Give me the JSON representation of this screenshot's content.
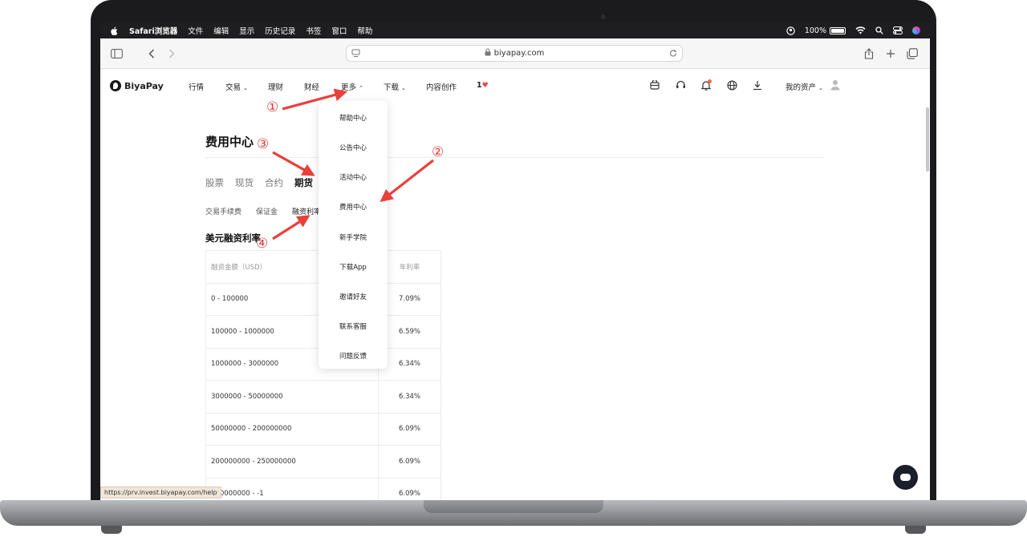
{
  "menubar": {
    "app": "Safari浏览器",
    "items": [
      "文件",
      "编辑",
      "显示",
      "历史记录",
      "书签",
      "窗口",
      "帮助"
    ],
    "battery_text": "100%"
  },
  "browser": {
    "url": "biyapay.com",
    "status_url": "https://prv.invest.biyapay.com/help"
  },
  "nav": {
    "logo": "BiyaPay",
    "items": [
      "行情",
      "交易",
      "理财",
      "财经",
      "更多",
      "下载",
      "内容创作",
      "1"
    ],
    "assets": "我的资产"
  },
  "dropdown": {
    "items": [
      "帮助中心",
      "公告中心",
      "活动中心",
      "费用中心",
      "新手学院",
      "下载App",
      "邀请好友",
      "联系客服",
      "问题反馈"
    ]
  },
  "page": {
    "title": "费用中心",
    "tabs": [
      "股票",
      "现货",
      "合约",
      "期货"
    ],
    "subtabs": [
      "交易手续费",
      "保证金",
      "融资利率"
    ],
    "section_title": "美元融资利率"
  },
  "table": {
    "headers": [
      "融资金额（USD）",
      "年利率"
    ],
    "rows": [
      {
        "range": "0 - 100000",
        "rate": "7.09%"
      },
      {
        "range": "100000 - 1000000",
        "rate": "6.59%"
      },
      {
        "range": "1000000 - 3000000",
        "rate": "6.34%"
      },
      {
        "range": "3000000 - 50000000",
        "rate": "6.34%"
      },
      {
        "range": "50000000 - 200000000",
        "rate": "6.09%"
      },
      {
        "range": "200000000 - 250000000",
        "rate": "6.09%"
      },
      {
        "range": "250000000 - -1",
        "rate": "6.09%"
      }
    ]
  },
  "annotations": {
    "steps": [
      "①",
      "②",
      "③",
      "④"
    ],
    "color": "#e03a3a"
  }
}
